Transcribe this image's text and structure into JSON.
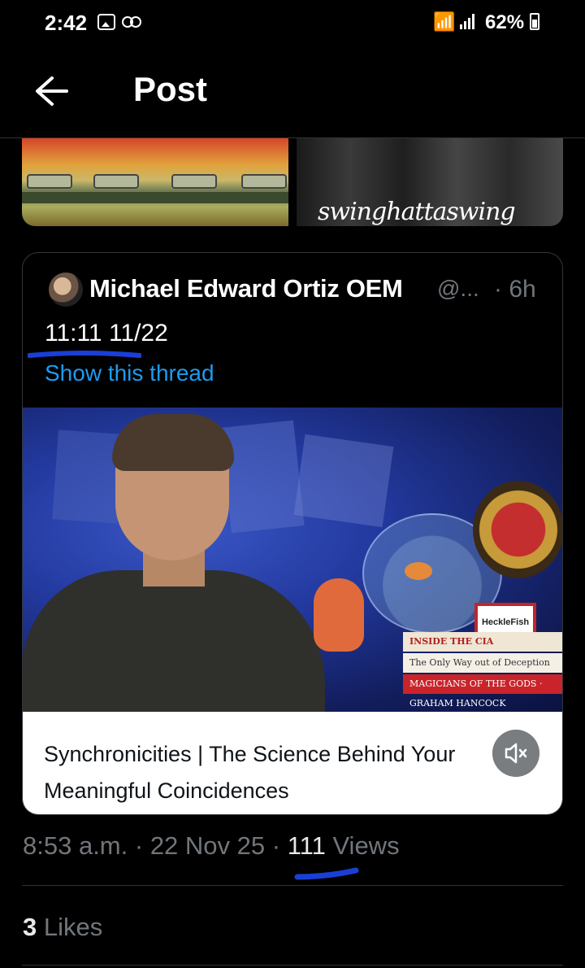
{
  "status_bar": {
    "time": "2:42",
    "battery": "62%",
    "icons": [
      "image-icon",
      "voicemail-icon",
      "wifi-icon",
      "signal-icon",
      "battery-icon"
    ]
  },
  "header": {
    "title": "Post",
    "back_icon": "arrow-left-icon"
  },
  "previous_media": {
    "right_caption": "swinghattaswing"
  },
  "quoted_post": {
    "author_name": "Michael Edward Ortiz OEM",
    "handle": "@...",
    "age": "· 6h",
    "text": "11:11 11/22",
    "show_thread": "Show this thread",
    "video": {
      "tag_text": "HeckleFish",
      "book1": "INSIDE THE CIA",
      "book2": "The Only Way out of Deception",
      "book3": "MAGICIANS OF THE GODS · GRAHAM HANCOCK"
    },
    "link_card": {
      "title_line1": "Synchronicities | The Science Behind Your",
      "title_line2": "Meaningful Coincidences"
    },
    "mute_icon": "speaker-muted-icon"
  },
  "meta": {
    "time": "8:53 a.m.",
    "sep1": " · ",
    "date": "22 Nov 25",
    "sep2": " · ",
    "views_count": "111",
    "views_label": " Views"
  },
  "likes": {
    "count": "3",
    "label": " Likes"
  },
  "colors": {
    "background": "#000000",
    "link": "#1d9bf0",
    "secondary_text": "#71767b",
    "annotation_marker": "#1a3fd6"
  }
}
